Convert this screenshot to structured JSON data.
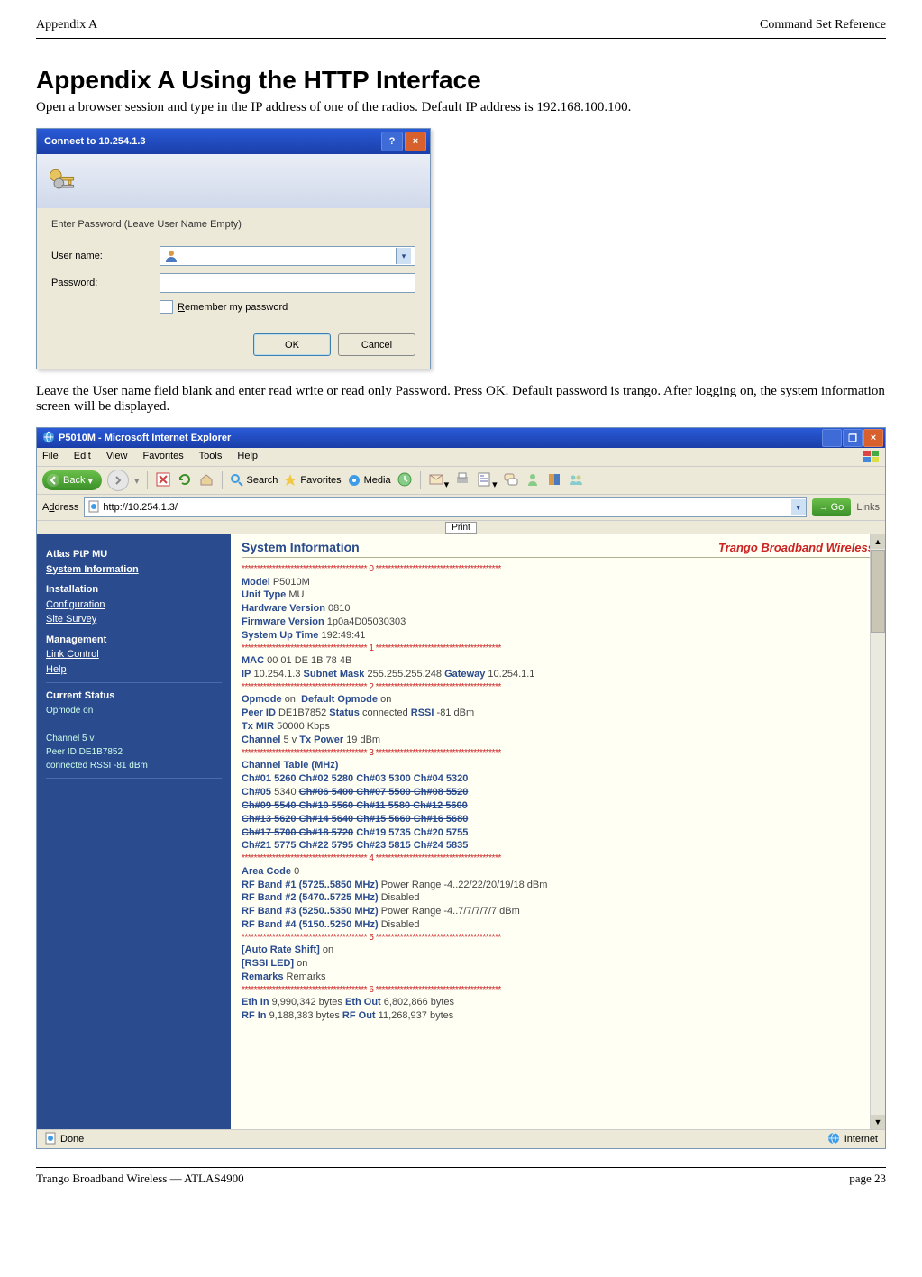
{
  "page_header": {
    "left": "Appendix A",
    "right": "Command Set Reference"
  },
  "title": "Appendix A   Using the HTTP Interface",
  "intro": "Open a browser session and type in the IP address of one of the radios.  Default IP address is 192.168.100.100.",
  "login": {
    "title": "Connect to 10.254.1.3",
    "prompt": "Enter Password (Leave User Name Empty)",
    "user_label": "User name:",
    "pass_label": "Password:",
    "remember": "Remember my password",
    "ok": "OK",
    "cancel": "Cancel"
  },
  "after_login": "Leave the User name field blank and enter read write or read only Password.  Press OK.  Default password is trango.  After logging on, the system information screen will be displayed.",
  "browser": {
    "title": "P5010M - Microsoft Internet Explorer",
    "menu": [
      "File",
      "Edit",
      "View",
      "Favorites",
      "Tools",
      "Help"
    ],
    "back": "Back",
    "search": "Search",
    "favorites": "Favorites",
    "media": "Media",
    "address_label": "Address",
    "url": "http://10.254.1.3/",
    "print": "Print",
    "go": "Go",
    "links": "Links",
    "status_left": "Done",
    "status_right": "Internet"
  },
  "sidebar": {
    "product": "Atlas PtP MU",
    "sysinfo": "System Information",
    "installation": "Installation",
    "config": "Configuration",
    "survey": "Site Survey",
    "management": "Management",
    "linkctrl": "Link Control",
    "help": "Help",
    "current_status": "Current Status",
    "opmode": "Opmode   on",
    "channel": "Channel    5 v",
    "peerid": "Peer ID    DE1B7852",
    "rssi_line": "  connected RSSI -81 dBm"
  },
  "content": {
    "heading": "System Information",
    "brand": "Trango Broadband Wireless",
    "sep": "***************************************** 0 *****************************************",
    "l_model": "Model",
    "v_model": "P5010M",
    "l_unit": "Unit Type",
    "v_unit": "MU",
    "l_hw": "Hardware Version",
    "v_hw": "0810",
    "l_fw": "Firmware Version",
    "v_fw": "1p0a4D05030303",
    "l_up": "System Up Time",
    "v_up": "192:49:41",
    "sep1": "***************************************** 1 *****************************************",
    "l_mac": "MAC",
    "v_mac": "00 01 DE 1B 78 4B",
    "l_ip": "IP",
    "v_ip": "10.254.1.3",
    "l_sn": "Subnet Mask",
    "v_sn": "255.255.255.248",
    "l_gw": "Gateway",
    "v_gw": "10.254.1.1",
    "sep2": "***************************************** 2 *****************************************",
    "l_op": "Opmode",
    "v_op": "on",
    "l_dop": "Default Opmode",
    "v_dop": "on",
    "l_peer": "Peer ID",
    "v_peer": "DE1B7852",
    "l_stat": "Status",
    "v_stat": "connected",
    "l_rssi": "RSSI",
    "v_rssi": "-81 dBm",
    "l_mir": "Tx MIR",
    "v_mir": "50000 Kbps",
    "l_ch": "Channel",
    "v_ch": "5 v",
    "l_txp": "Tx Power",
    "v_txp": "19 dBm",
    "sep3": "***************************************** 3 *****************************************",
    "l_ctbl": "Channel Table (MHz)",
    "ct1": "Ch#01 5260 Ch#02 5280 Ch#03 5300 Ch#04 5320",
    "ct2a": "Ch#05",
    "ct2b": "5340",
    "ct2s": "Ch#06 5400 Ch#07 5500 Ch#08 5520",
    "ct3s": "Ch#09 5540 Ch#10 5560 Ch#11 5580 Ch#12 5600",
    "ct4s": "Ch#13 5620 Ch#14 5640 Ch#15 5660 Ch#16 5680",
    "ct5sa": "Ch#17 5700 Ch#18 5720",
    "ct5b": "Ch#19 5735 Ch#20 5755",
    "ct6": "Ch#21 5775 Ch#22 5795 Ch#23 5815 Ch#24 5835",
    "sep4": "***************************************** 4 *****************************************",
    "l_area": "Area Code",
    "v_area": "0",
    "l_b1": "RF Band #1 (5725..5850 MHz)",
    "v_b1": "Power Range -4..22/22/20/19/18 dBm",
    "l_b2": "RF Band #2 (5470..5725 MHz)",
    "v_b2": "Disabled",
    "l_b3": "RF Band #3 (5250..5350 MHz)",
    "v_b3": "Power Range -4..7/7/7/7/7 dBm",
    "l_b4": "RF Band #4 (5150..5250 MHz)",
    "v_b4": "Disabled",
    "sep5": "***************************************** 5 *****************************************",
    "l_ars": "[Auto Rate Shift]",
    "v_ars": "on",
    "l_led": "[RSSI LED]",
    "v_led": "on",
    "l_rem": "Remarks",
    "v_rem": "Remarks",
    "sep6": "***************************************** 6 *****************************************",
    "l_ein": "Eth In",
    "v_ein": "9,990,342 bytes",
    "l_eout": "Eth Out",
    "v_eout": "6,802,866 bytes",
    "l_rin": "RF In",
    "v_rin": "9,188,383 bytes",
    "l_rout": "RF Out",
    "v_rout": "11,268,937 bytes"
  },
  "footer": {
    "left": "Trango Broadband Wireless — ATLAS4900",
    "right": "page 23"
  }
}
